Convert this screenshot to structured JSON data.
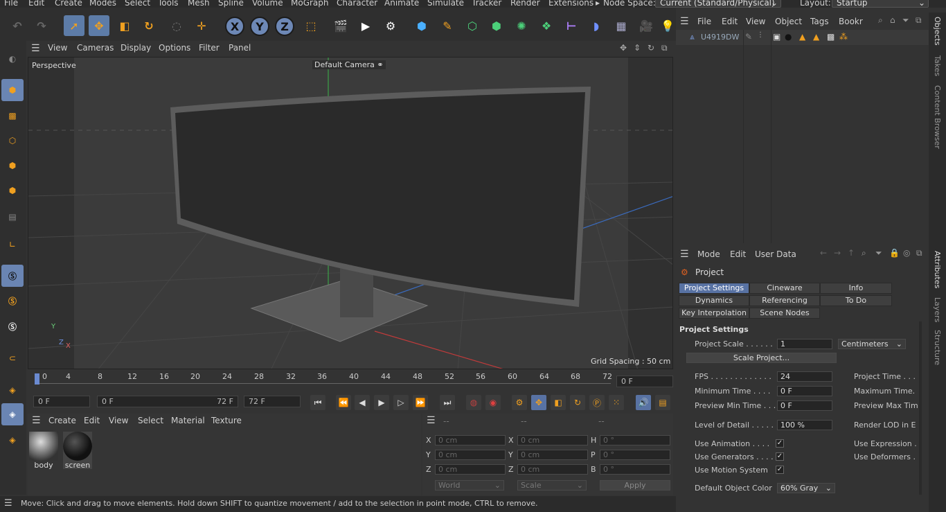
{
  "menubar": {
    "items": [
      "File",
      "Edit",
      "Create",
      "Modes",
      "Select",
      "Tools",
      "Mesh",
      "Spline",
      "Volume",
      "MoGraph",
      "Character",
      "Animate",
      "Simulate",
      "Tracker",
      "Render",
      "Extensions"
    ],
    "node_space_label": "Node Space:",
    "node_space_value": "Current (Standard/Physical)",
    "layout_label": "Layout:",
    "layout_value": "Startup"
  },
  "viewport": {
    "menu": [
      "View",
      "Cameras",
      "Display",
      "Options",
      "Filter",
      "Panel"
    ],
    "view_name": "Perspective",
    "camera_name": "Default Camera",
    "grid_spacing": "Grid Spacing : 50 cm",
    "axis_y": "Y",
    "axis_z": "Z",
    "axis_x": "X"
  },
  "timeline": {
    "ticks": [
      "0",
      "4",
      "8",
      "12",
      "16",
      "20",
      "24",
      "28",
      "32",
      "36",
      "40",
      "44",
      "48",
      "52",
      "56",
      "60",
      "64",
      "68",
      "72"
    ],
    "current_frame": "0 F"
  },
  "transport": {
    "start": "0 F",
    "range_start": "0 F",
    "range_end": "72 F",
    "end": "72 F"
  },
  "material_panel": {
    "menu": [
      "Create",
      "Edit",
      "View",
      "Select",
      "Material",
      "Texture"
    ],
    "materials": [
      "body",
      "screen"
    ]
  },
  "coord_panel": {
    "header": [
      "--",
      "--",
      "--"
    ],
    "rows": [
      {
        "a": "X",
        "av": "0 cm",
        "b": "X",
        "bv": "0 cm",
        "c": "H",
        "cv": "0 °"
      },
      {
        "a": "Y",
        "av": "0 cm",
        "b": "Y",
        "bv": "0 cm",
        "c": "P",
        "cv": "0 °"
      },
      {
        "a": "Z",
        "av": "0 cm",
        "b": "Z",
        "bv": "0 cm",
        "c": "B",
        "cv": "0 °"
      }
    ],
    "space": "World",
    "mode": "Scale",
    "apply": "Apply"
  },
  "status": "Move: Click and drag to move elements. Hold down SHIFT to quantize movement / add to the selection in point mode, CTRL to remove.",
  "object_panel": {
    "menu": [
      "File",
      "Edit",
      "View",
      "Object",
      "Tags",
      "Bookr"
    ],
    "object_name": "U4919DW"
  },
  "attr_panel": {
    "menu": [
      "Mode",
      "Edit",
      "User Data"
    ],
    "title": "Project",
    "tabs": [
      "Project Settings",
      "Cineware",
      "Info",
      "Dynamics",
      "Referencing",
      "To Do",
      "Key Interpolation",
      "Scene Nodes"
    ],
    "section": "Project Settings",
    "project_scale_label": "Project Scale . . . . . .",
    "project_scale_value": "1",
    "project_scale_unit": "Centimeters",
    "scale_project_btn": "Scale Project...",
    "fps_label": "FPS . . . . . . . . . . . . .",
    "fps_value": "24",
    "project_time_label": "Project Time . . .",
    "min_time_label": "Minimum Time . . . .",
    "min_time_value": "0 F",
    "max_time_label": "Maximum Time.",
    "preview_min_label": "Preview Min Time . . .",
    "preview_min_value": "0 F",
    "preview_max_label": "Preview Max Tim",
    "lod_label": "Level of Detail . . . . .",
    "lod_value": "100 %",
    "render_lod_label": "Render LOD in E",
    "use_animation": "Use Animation . . . .",
    "use_expression": "Use Expression .",
    "use_generators": "Use Generators . . . .",
    "use_deformers": "Use Deformers .",
    "use_motion": "Use Motion System",
    "default_color_label": "Default Object Color",
    "default_color_value": "60% Gray"
  },
  "siderail": {
    "top_tabs": [
      "Objects",
      "Takes",
      "Content Browser"
    ],
    "bottom_tabs": [
      "Attributes",
      "Layers",
      "Structure"
    ]
  }
}
